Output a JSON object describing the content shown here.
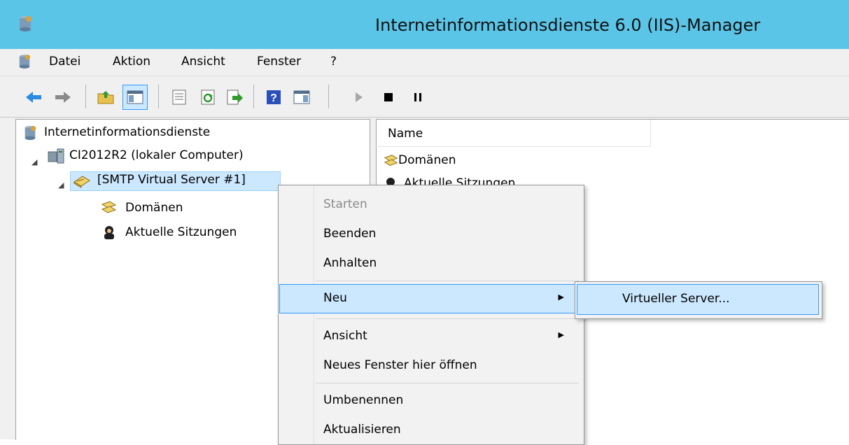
{
  "window": {
    "title": "Internetinformationsdienste 6.0 (IIS)-Manager",
    "icon": "iis-app-icon"
  },
  "menubar": {
    "items": [
      "Datei",
      "Aktion",
      "Ansicht",
      "Fenster",
      "?"
    ]
  },
  "toolbar": {
    "buttons": [
      "back-icon",
      "forward-icon",
      "up-folder-icon",
      "show-hide-tree-icon",
      "properties-icon",
      "refresh-icon",
      "export-list-icon",
      "help-icon",
      "show-hide-action-pane-icon",
      "play-icon",
      "stop-icon",
      "pause-icon"
    ]
  },
  "tree": {
    "root": "Internetinformationsdienste",
    "computer": "CI2012R2 (lokaler Computer)",
    "server": "[SMTP Virtual Server #1]",
    "children": [
      "Domänen",
      "Aktuelle Sitzungen"
    ]
  },
  "list": {
    "column_name": "Name",
    "rows": [
      "Domänen",
      "Aktuelle Sitzungen"
    ]
  },
  "context_menu": {
    "items": [
      "Starten",
      "Beenden",
      "Anhalten",
      "Neu",
      "Ansicht",
      "Neues Fenster hier öffnen",
      "Umbenennen",
      "Aktualisieren"
    ],
    "disabled": [
      "Starten"
    ],
    "highlighted": "Neu"
  },
  "submenu": {
    "items": [
      "Virtueller Server..."
    ]
  },
  "colors": {
    "titlebar": "#5bc5e8",
    "selection": "#cce8ff",
    "selection_border": "#3399ff"
  }
}
